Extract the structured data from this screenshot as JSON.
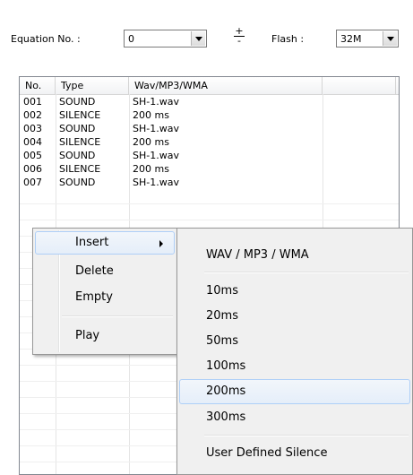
{
  "top_fragment": "",
  "toolbar": {
    "equation_label": "Equation No. :",
    "equation_value": "0",
    "plus": "+",
    "minus": "-",
    "flash_label": "Flash :",
    "flash_value": "32M"
  },
  "list": {
    "columns": [
      "No.",
      "Type",
      "Wav/MP3/WMA",
      ""
    ],
    "rows": [
      {
        "no": "001",
        "type": "SOUND",
        "file": "SH-1.wav"
      },
      {
        "no": "002",
        "type": "SILENCE",
        "file": "200 ms"
      },
      {
        "no": "003",
        "type": "SOUND",
        "file": "SH-1.wav"
      },
      {
        "no": "004",
        "type": "SILENCE",
        "file": "200 ms"
      },
      {
        "no": "005",
        "type": "SOUND",
        "file": "SH-1.wav"
      },
      {
        "no": "006",
        "type": "SILENCE",
        "file": "200 ms"
      },
      {
        "no": "007",
        "type": "SOUND",
        "file": "SH-1.wav"
      }
    ]
  },
  "context_menu": {
    "insert": "Insert",
    "delete": "Delete",
    "empty": "Empty",
    "play": "Play"
  },
  "submenu": {
    "wav": "WAV / MP3 / WMA",
    "ms10": "10ms",
    "ms20": "20ms",
    "ms50": "50ms",
    "ms100": "100ms",
    "ms200": "200ms",
    "ms300": "300ms",
    "user_defined": "User Defined Silence"
  },
  "colors": {
    "menu_bg": "#f0f0f0",
    "highlight_border": "#aecff7",
    "highlight_bg": "#e5eef9"
  }
}
